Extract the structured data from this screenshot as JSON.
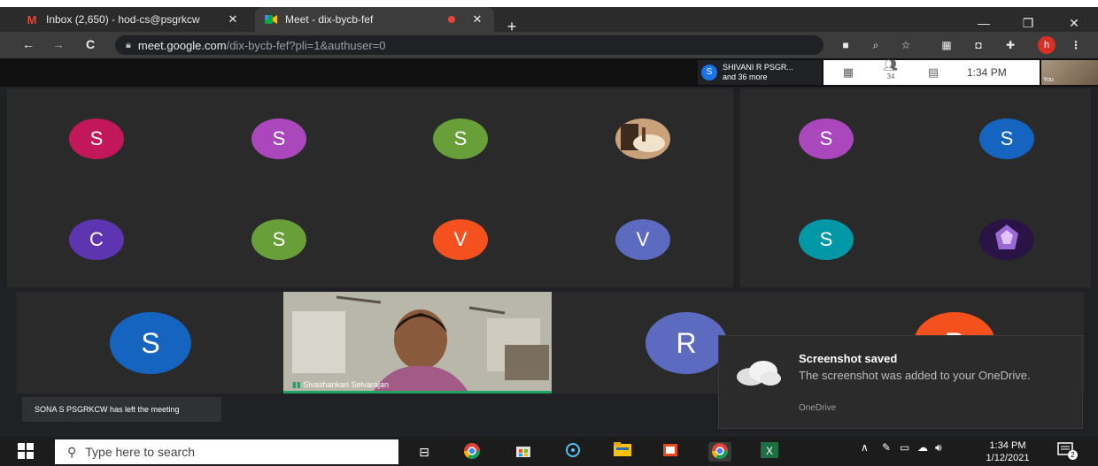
{
  "browser": {
    "tabs": [
      {
        "label": "Inbox (2,650) - hod-cs@psgrkcw",
        "icon": "gmail-icon",
        "close": "✕"
      },
      {
        "label": "Meet - dix-bycb-fef",
        "icon": "meet-icon",
        "close": "✕"
      }
    ],
    "new_tab": "+",
    "window_controls": {
      "minimize": "—",
      "maximize": "❐",
      "close": "✕"
    },
    "nav": {
      "back": "←",
      "forward": "→",
      "reload": "C"
    },
    "url": {
      "host": "meet.google.com",
      "path": "/dix-bycb-fef?pli=1&authuser=0"
    },
    "profile_initial": "h"
  },
  "meet": {
    "presenter": {
      "initial": "S",
      "name": "SHIVANI R PSGR...",
      "others": "and 36 more"
    },
    "toolbar": {
      "participants_count": "34",
      "time": "1:34 PM"
    },
    "self_view_label": "You",
    "tiles": [
      {
        "initial": "S",
        "color": "#c2185b"
      },
      {
        "initial": "S",
        "color": "#ab47bc"
      },
      {
        "initial": "S",
        "color": "#689f38"
      },
      {
        "initial": "",
        "color": "#6d4c41"
      },
      {
        "initial": "S",
        "color": "#ab47bc"
      },
      {
        "initial": "S",
        "color": "#1565c0"
      },
      {
        "initial": "C",
        "color": "#5e35b1"
      },
      {
        "initial": "S",
        "color": "#689f38"
      },
      {
        "initial": "V",
        "color": "#f4511e"
      },
      {
        "initial": "V",
        "color": "#5c6bc0"
      },
      {
        "initial": "S",
        "color": "#0097a7"
      },
      {
        "initial": "",
        "color": "#7e57c2"
      },
      {
        "initial": "S",
        "color": "#1565c0"
      },
      {
        "initial": "R",
        "color": "#5c6bc0"
      },
      {
        "initial": "R",
        "color": "#f4511e"
      }
    ],
    "video_tile_name": "Sivashankari Selvarajan",
    "left_notice": "SONA S PSGRKCW has left the meeting"
  },
  "toast": {
    "title": "Screenshot saved",
    "message": "The screenshot was added to your OneDrive.",
    "source": "OneDrive"
  },
  "taskbar": {
    "search_placeholder": "Type here to search",
    "time": "1:34 PM",
    "date": "1/12/2021",
    "notification_count": "2"
  }
}
